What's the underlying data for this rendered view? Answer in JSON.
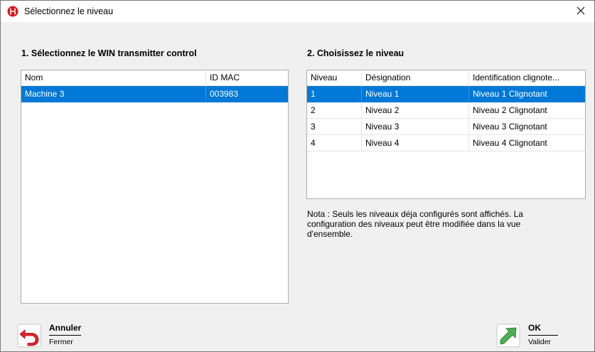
{
  "window": {
    "title": "Sélectionnez le niveau",
    "close_glyph": "✕",
    "title_icon": "hager-logo-icon",
    "accent_color": "#0078d7"
  },
  "left_panel": {
    "title": "1. Sélectionnez le WIN transmitter control",
    "columns": [
      "Nom",
      "ID MAC"
    ],
    "rows": [
      {
        "nom": "Machine 3",
        "id_mac": "003983",
        "selected": true
      }
    ]
  },
  "right_panel": {
    "title": "2. Choisissez le niveau",
    "columns": [
      "Niveau",
      "Désignation",
      "Identification clignote..."
    ],
    "rows": [
      {
        "niveau": "1",
        "designation": "Niveau 1",
        "identification": "Niveau 1 Clignotant",
        "selected": true
      },
      {
        "niveau": "2",
        "designation": "Niveau 2",
        "identification": "Niveau 2 Clignotant",
        "selected": false
      },
      {
        "niveau": "3",
        "designation": "Niveau 3",
        "identification": "Niveau 3 Clignotant",
        "selected": false
      },
      {
        "niveau": "4",
        "designation": "Niveau 4",
        "identification": "Niveau 4 Clignotant",
        "selected": false
      }
    ],
    "note": "Nota : Seuls les niveaux déja configurés sont affichés. La configuration des niveaux peut être modifiée dans la vue d'ensemble."
  },
  "footer": {
    "cancel": {
      "label": "Annuler",
      "sub": "Fermer",
      "icon": "undo-arrow-icon"
    },
    "ok": {
      "label": "OK",
      "sub": "Valider",
      "icon": "confirm-arrow-icon"
    }
  }
}
